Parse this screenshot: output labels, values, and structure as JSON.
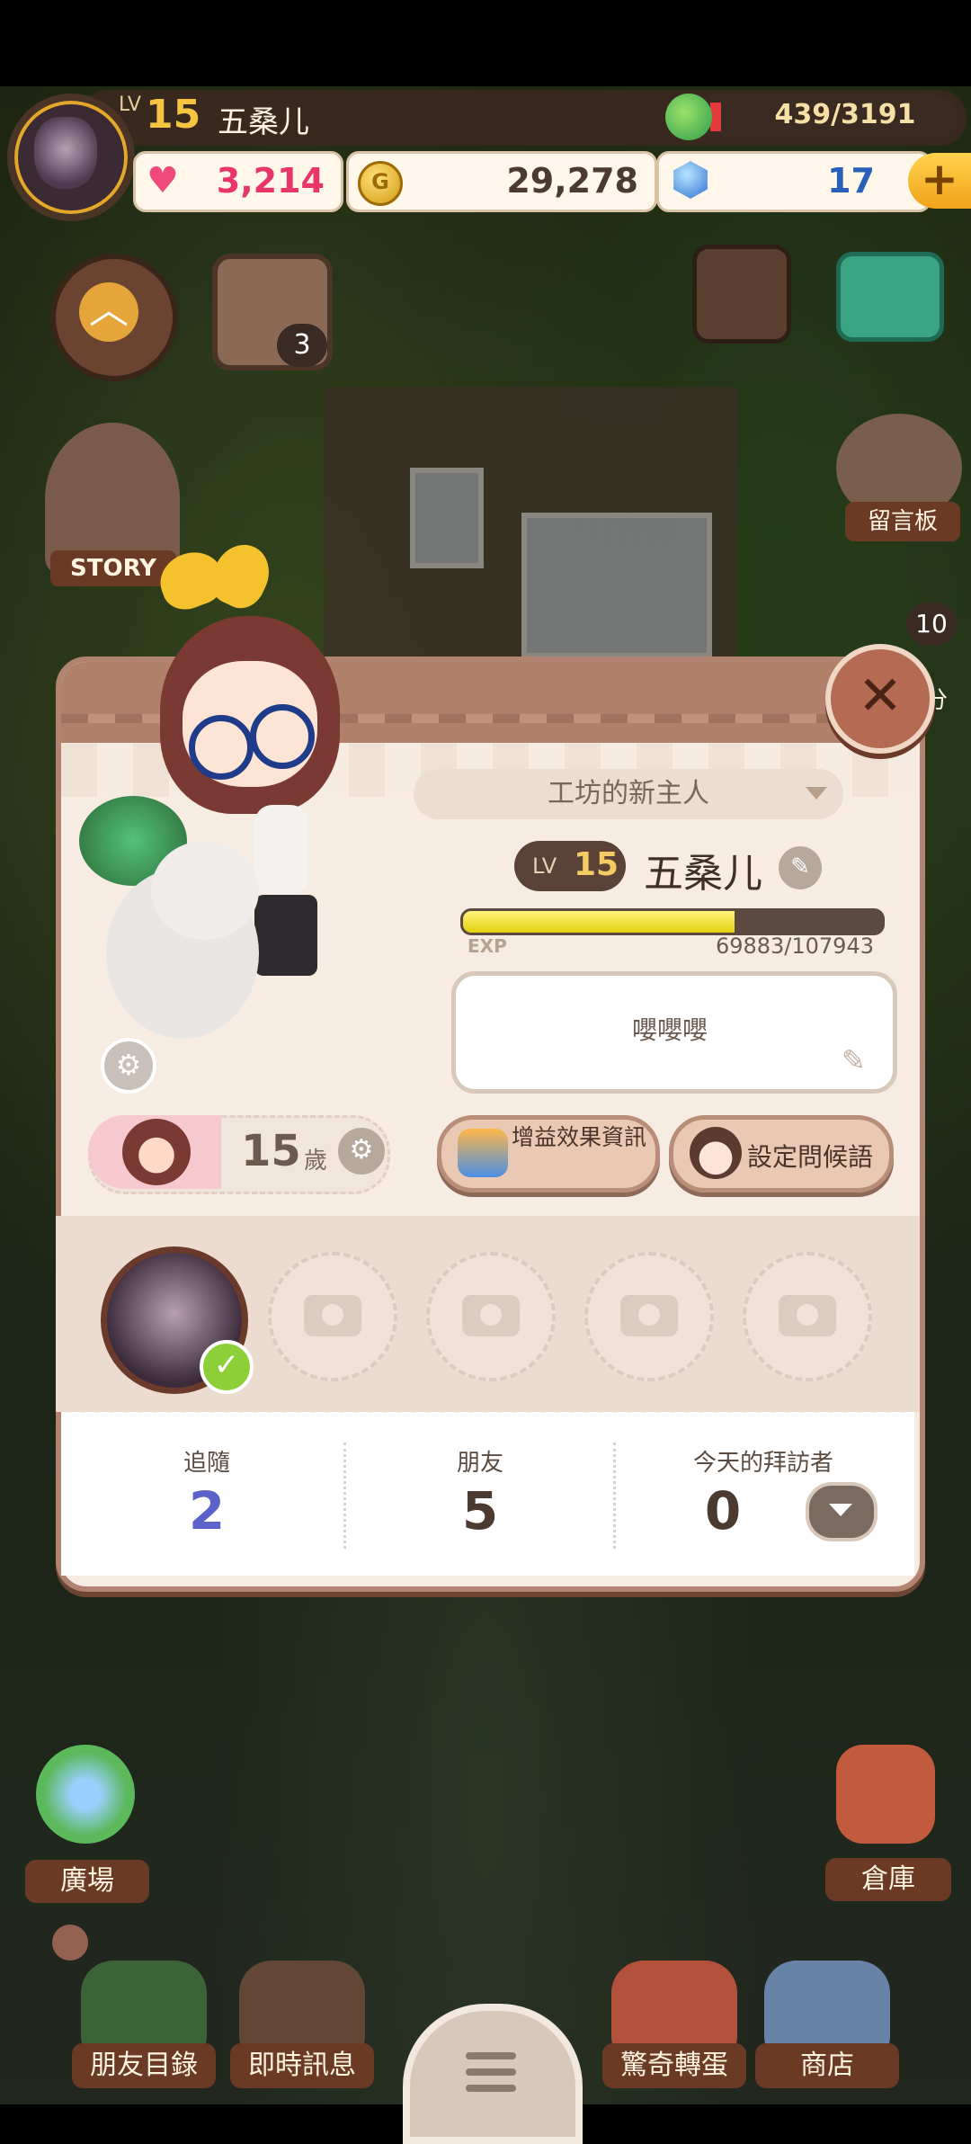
{
  "hud": {
    "level_tag": "LV",
    "level": "15",
    "player_name": "五桑儿",
    "energy": "439/3191",
    "hearts": "3,214",
    "coins": "29,278",
    "gems": "17",
    "coin_symbol": "G",
    "add_symbol": "+"
  },
  "left_menu": {
    "calendar_badge": "3",
    "story_label": "STORY"
  },
  "right_menu": {
    "board_label": "留言板",
    "badge_count": "10",
    "partial_label": "分"
  },
  "profile": {
    "title": "工坊的新主人",
    "level_tag": "LV",
    "level": "15",
    "name": "五桑儿",
    "exp_label": "EXP",
    "exp_value": "69883/107943",
    "exp_fraction": 0.647,
    "greeting": "嚶嚶嚶",
    "age_number": "15",
    "age_unit": "歲",
    "buff_button": "增益效果資訊",
    "greeting_button": "設定問候語",
    "close_symbol": "✕",
    "photo_slots": 4,
    "stats": {
      "follow_label": "追隨",
      "follow_value": "2",
      "friends_label": "朋友",
      "friends_value": "5",
      "visitors_label": "今天的拜訪者",
      "visitors_value": "0"
    }
  },
  "bottom_nav": {
    "plaza": "廣場",
    "storage": "倉庫",
    "friends_list": "朋友目錄",
    "instant_msg": "即時訊息",
    "gacha": "驚奇轉蛋",
    "shop": "商店"
  },
  "colors": {
    "follow_value": "#5b62c9",
    "friends_value": "#4a3a30",
    "visitors_value": "#4a3a30",
    "hearts_value": "#e8366b",
    "coins_value": "#4a3a30",
    "gems_value": "#2a5fb8"
  },
  "icons": [
    "heart-icon",
    "coin-icon",
    "gem-icon",
    "plus-icon",
    "leaf-icon",
    "chevron-up-icon",
    "calendar-icon",
    "close-icon",
    "pencil-icon",
    "gear-icon",
    "camera-icon",
    "check-icon",
    "chevron-down-icon",
    "menu-icon"
  ]
}
